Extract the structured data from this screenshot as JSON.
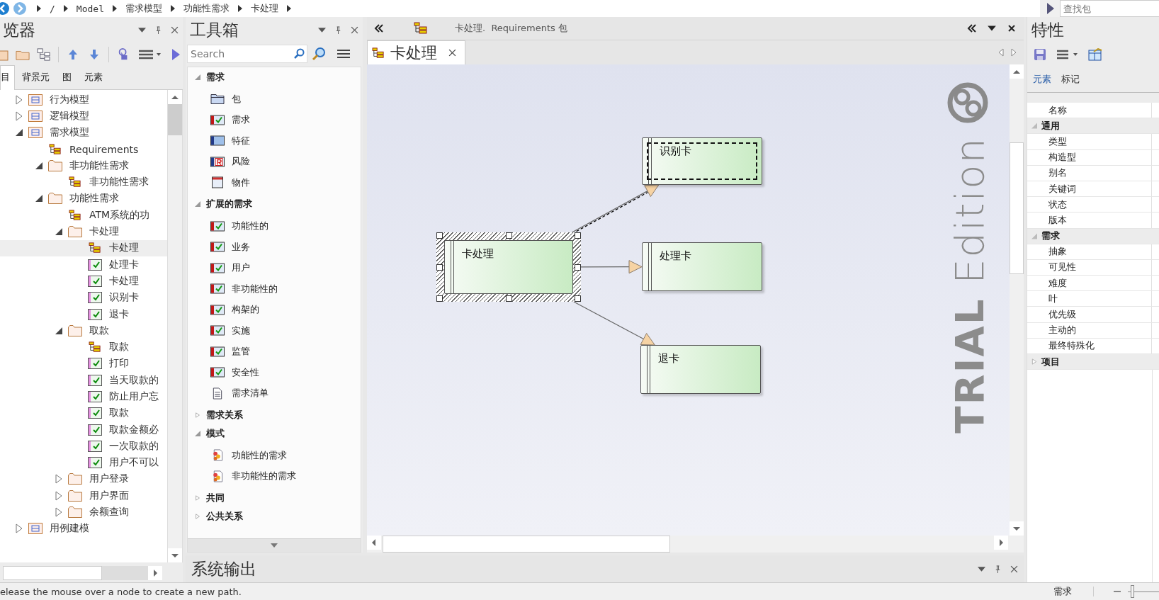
{
  "breadcrumb": [
    "/",
    "Model",
    "需求模型",
    "功能性需求",
    "卡处理"
  ],
  "find_package": {
    "placeholder": "查找包"
  },
  "browser": {
    "title": "览器",
    "tabs": [
      {
        "label": "目",
        "selected": true
      },
      {
        "label": "背景元",
        "selected": false
      },
      {
        "label": "图",
        "selected": false
      },
      {
        "label": "元素",
        "selected": false
      }
    ],
    "tree": [
      {
        "label": "行为模型",
        "kind": "model",
        "expanded": false,
        "selected": false
      },
      {
        "label": "逻辑模型",
        "kind": "model",
        "expanded": false,
        "selected": false
      },
      {
        "label": "需求模型",
        "kind": "model",
        "expanded": true,
        "selected": false,
        "children": [
          {
            "label": "Requirements",
            "kind": "diagram",
            "selected": false
          },
          {
            "label": "非功能性需求",
            "kind": "folder",
            "expanded": true,
            "selected": false,
            "children": [
              {
                "label": "非功能性需求",
                "kind": "diagram",
                "selected": false
              }
            ]
          },
          {
            "label": "功能性需求",
            "kind": "folder",
            "expanded": true,
            "selected": false,
            "children": [
              {
                "label": "ATM系统的功",
                "kind": "diagram",
                "selected": false
              },
              {
                "label": "卡处理",
                "kind": "folder",
                "expanded": true,
                "selected": false,
                "children": [
                  {
                    "label": "卡处理",
                    "kind": "diagram",
                    "selected": true
                  },
                  {
                    "label": "处理卡",
                    "kind": "requirement",
                    "selected": false
                  },
                  {
                    "label": "卡处理",
                    "kind": "requirement",
                    "selected": false
                  },
                  {
                    "label": "识别卡",
                    "kind": "requirement",
                    "selected": false
                  },
                  {
                    "label": "退卡",
                    "kind": "requirement",
                    "selected": false
                  }
                ]
              },
              {
                "label": "取款",
                "kind": "folder",
                "expanded": true,
                "selected": false,
                "children": [
                  {
                    "label": "取款",
                    "kind": "diagram",
                    "selected": false
                  },
                  {
                    "label": "打印",
                    "kind": "requirement",
                    "selected": false
                  },
                  {
                    "label": "当天取款的",
                    "kind": "requirement",
                    "selected": false
                  },
                  {
                    "label": "防止用户忘",
                    "kind": "requirement",
                    "selected": false
                  },
                  {
                    "label": "取款",
                    "kind": "requirement",
                    "selected": false
                  },
                  {
                    "label": "取款金额必",
                    "kind": "requirement",
                    "selected": false
                  },
                  {
                    "label": "一次取款的",
                    "kind": "requirement",
                    "selected": false
                  },
                  {
                    "label": "用户不可以",
                    "kind": "requirement",
                    "selected": false
                  }
                ]
              },
              {
                "label": "用户登录",
                "kind": "folder",
                "expanded": false,
                "selected": false
              },
              {
                "label": "用户界面",
                "kind": "folder",
                "expanded": false,
                "selected": false
              },
              {
                "label": "余额查询",
                "kind": "folder",
                "expanded": false,
                "selected": false
              }
            ]
          }
        ]
      },
      {
        "label": "用例建模",
        "kind": "model",
        "expanded": false,
        "selected": false
      }
    ]
  },
  "toolbox": {
    "title": "工具箱",
    "search": {
      "placeholder": "Search"
    },
    "sections": [
      {
        "title": "需求",
        "expanded": true,
        "items": [
          {
            "label": "包",
            "kind": "package"
          },
          {
            "label": "需求",
            "kind": "requirement"
          },
          {
            "label": "特征",
            "kind": "feature"
          },
          {
            "label": "风险",
            "kind": "risk"
          },
          {
            "label": "物件",
            "kind": "artifact"
          }
        ]
      },
      {
        "title": "扩展的需求",
        "expanded": true,
        "items": [
          {
            "label": "功能性的",
            "kind": "requirement"
          },
          {
            "label": "业务",
            "kind": "requirement"
          },
          {
            "label": "用户",
            "kind": "requirement"
          },
          {
            "label": "非功能性的",
            "kind": "requirement"
          },
          {
            "label": "构架的",
            "kind": "requirement"
          },
          {
            "label": "实施",
            "kind": "requirement"
          },
          {
            "label": "监管",
            "kind": "requirement"
          },
          {
            "label": "安全性",
            "kind": "requirement"
          },
          {
            "label": "需求清单",
            "kind": "checklist"
          }
        ]
      },
      {
        "title": "需求关系",
        "expanded": false
      },
      {
        "title": "模式",
        "expanded": true,
        "items": [
          {
            "label": "功能性的需求",
            "kind": "pattern"
          },
          {
            "label": "非功能性的需求",
            "kind": "pattern"
          }
        ]
      },
      {
        "title": "共同",
        "expanded": false
      },
      {
        "title": "公共关系",
        "expanded": false
      }
    ]
  },
  "diagram": {
    "caption": "卡处理.  Requirements 包",
    "tab": {
      "label": "卡处理",
      "selected": true
    },
    "trial_banner": "**TRIAL** Edition",
    "nodes": [
      {
        "name": "卡处理",
        "selected": true,
        "focused": false
      },
      {
        "name": "识别卡",
        "selected": false,
        "focused": true
      },
      {
        "name": "处理卡",
        "selected": false,
        "focused": false
      },
      {
        "name": "退卡",
        "selected": false,
        "focused": false
      }
    ],
    "connectors": [
      {
        "selected": true
      },
      {
        "selected": false
      },
      {
        "selected": false
      }
    ]
  },
  "output": {
    "title": "系统输出"
  },
  "properties": {
    "title": "特性",
    "tabs": [
      {
        "label": "元素",
        "selected": true
      },
      {
        "label": "标记",
        "selected": false
      }
    ],
    "rows": [
      {
        "kind": "field",
        "label": "名称"
      },
      {
        "kind": "group",
        "label": "通用",
        "expanded": true
      },
      {
        "kind": "field",
        "label": "类型"
      },
      {
        "kind": "field",
        "label": "构造型"
      },
      {
        "kind": "field",
        "label": "别名"
      },
      {
        "kind": "field",
        "label": "关键词"
      },
      {
        "kind": "field",
        "label": "状态"
      },
      {
        "kind": "field",
        "label": "版本"
      },
      {
        "kind": "group",
        "label": "需求",
        "expanded": true
      },
      {
        "kind": "field",
        "label": "抽象"
      },
      {
        "kind": "field",
        "label": "可见性"
      },
      {
        "kind": "field",
        "label": "难度"
      },
      {
        "kind": "field",
        "label": "叶"
      },
      {
        "kind": "field",
        "label": "优先级"
      },
      {
        "kind": "field",
        "label": "主动的"
      },
      {
        "kind": "field",
        "label": "最终特殊化"
      },
      {
        "kind": "group",
        "label": "项目",
        "expanded": false
      }
    ]
  },
  "status_bar": {
    "message": "elease the mouse over a node to create a new path.",
    "context": "需求",
    "zoom": {
      "level": 0.1
    }
  }
}
